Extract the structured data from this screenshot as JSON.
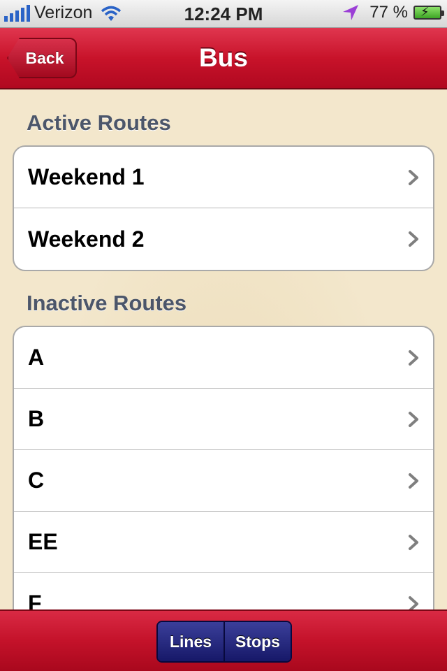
{
  "status_bar": {
    "carrier": "Verizon",
    "time": "12:24 PM",
    "battery_percent": "77 %"
  },
  "nav": {
    "back_label": "Back",
    "title": "Bus"
  },
  "sections": {
    "active": {
      "header": "Active Routes",
      "items": [
        "Weekend 1",
        "Weekend 2"
      ]
    },
    "inactive": {
      "header": "Inactive Routes",
      "items": [
        "A",
        "B",
        "C",
        "EE",
        "F"
      ]
    }
  },
  "bottom": {
    "segments": [
      "Lines",
      "Stops"
    ]
  },
  "colors": {
    "nav_red": "#c8132a",
    "segment_blue": "#1e2070",
    "background_tan": "#f3e7cc",
    "section_header": "#4c566a"
  },
  "icons": [
    "signal-icon",
    "wifi-icon",
    "location-arrow-icon",
    "battery-icon",
    "chevron-right-icon"
  ]
}
